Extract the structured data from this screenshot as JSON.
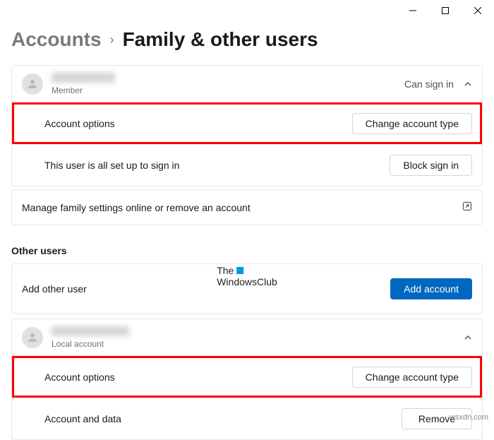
{
  "window": {
    "minimize_label": "Minimize",
    "maximize_label": "Maximize",
    "close_label": "Close"
  },
  "breadcrumb": {
    "parent": "Accounts",
    "separator": "›",
    "current": "Family & other users"
  },
  "family_user": {
    "name": "",
    "role": "Member",
    "status": "Can sign in",
    "account_options_label": "Account options",
    "change_account_type_label": "Change account type",
    "signin_status_label": "This user is all set up to sign in",
    "block_signin_label": "Block sign in"
  },
  "manage_family": {
    "label": "Manage family settings online or remove an account"
  },
  "other_users": {
    "section_label": "Other users",
    "add_label": "Add other user",
    "add_button_label": "Add account"
  },
  "local_user": {
    "name": "",
    "role": "Local account",
    "account_options_label": "Account options",
    "change_account_type_label": "Change account type",
    "account_data_label": "Account and data",
    "remove_label": "Remove"
  },
  "watermark": {
    "line1": "The",
    "line2": "WindowsClub"
  },
  "attribution": "wsxdn.com"
}
